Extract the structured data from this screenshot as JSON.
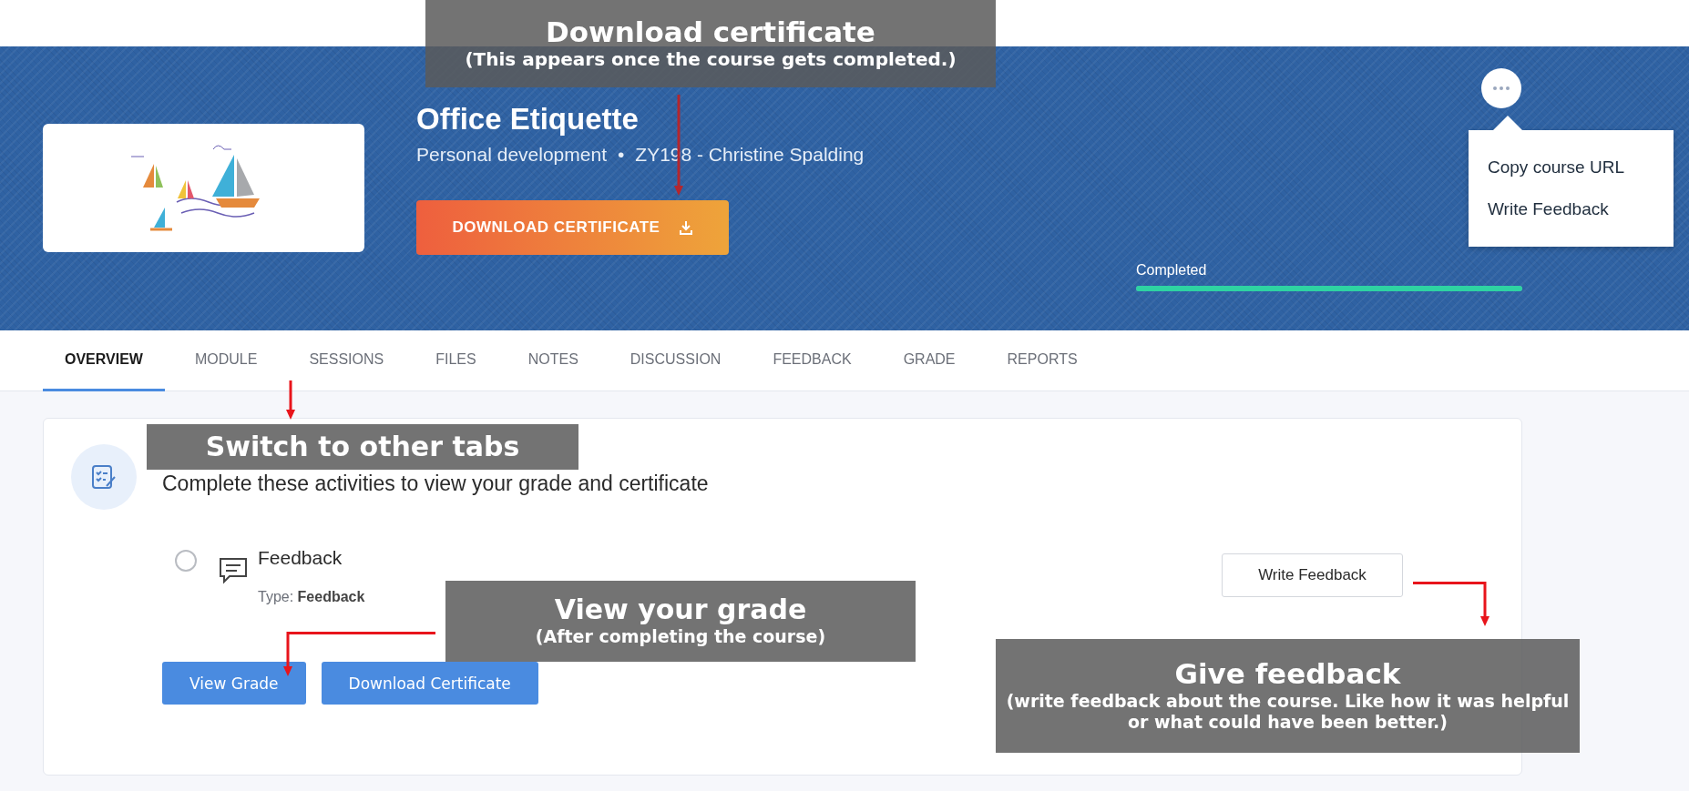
{
  "course": {
    "title": "Office Etiquette",
    "category": "Personal development",
    "separator": "•",
    "code_instructor": "ZY198 - Christine Spalding",
    "download_button": "DOWNLOAD CERTIFICATE",
    "more_menu": {
      "expanded": true,
      "items": [
        "Copy course URL",
        "Write Feedback"
      ]
    },
    "progress": {
      "label": "Completed",
      "level": 1
    }
  },
  "tabs": [
    {
      "label": "OVERVIEW",
      "selected": true
    },
    {
      "label": "MODULE",
      "selected": false
    },
    {
      "label": "SESSIONS",
      "selected": false
    },
    {
      "label": "FILES",
      "selected": false
    },
    {
      "label": "NOTES",
      "selected": false
    },
    {
      "label": "DISCUSSION",
      "selected": false
    },
    {
      "label": "FEEDBACK",
      "selected": false
    },
    {
      "label": "GRADE",
      "selected": false
    },
    {
      "label": "REPORTS",
      "selected": false
    }
  ],
  "overview": {
    "heading": "Complete these activities to view your grade and certificate",
    "activities": [
      {
        "title": "Feedback",
        "type_label": "Type:",
        "type_value": "Feedback",
        "checked": false,
        "action": "Write Feedback"
      }
    ],
    "buttons": [
      "View Grade",
      "Download Certificate"
    ]
  },
  "annotations": [
    {
      "kind": "top",
      "title": "Download certificate",
      "note": "(This appears once the course gets completed.)"
    },
    {
      "kind": "tabs",
      "title": "Switch to other tabs"
    },
    {
      "kind": "grade",
      "title": "View your grade",
      "note": "(After completing the course)"
    },
    {
      "kind": "feedback",
      "title": "Give feedback",
      "note": "(write feedback about the course. Like how it was helpful or what could have been better.)"
    }
  ]
}
